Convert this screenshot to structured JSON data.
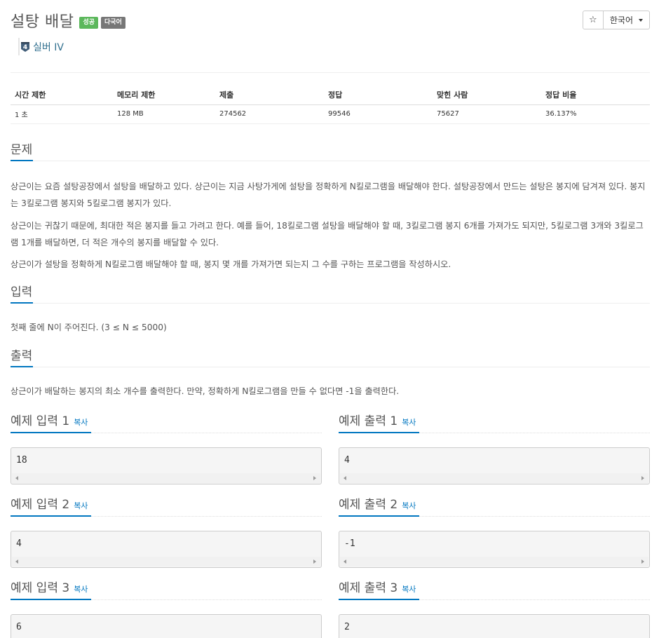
{
  "problem": {
    "title": "설탕 배달",
    "badges": {
      "success": "성공",
      "multilang": "다국어"
    },
    "tier": {
      "level": "4",
      "label": "실버 IV"
    }
  },
  "toolbar": {
    "star": "☆",
    "language": "한국어"
  },
  "info_table": {
    "headers": [
      "시간 제한",
      "메모리 제한",
      "제출",
      "정답",
      "맞힌 사람",
      "정답 비율"
    ],
    "values": [
      "1 초",
      "128 MB",
      "274562",
      "99546",
      "75627",
      "36.137%"
    ]
  },
  "sections": {
    "problem": {
      "heading": "문제",
      "paragraphs": [
        "상근이는 요즘 설탕공장에서 설탕을 배달하고 있다. 상근이는 지금 사탕가게에 설탕을 정확하게 N킬로그램을 배달해야 한다. 설탕공장에서 만드는 설탕은 봉지에 담겨져 있다. 봉지는 3킬로그램 봉지와 5킬로그램 봉지가 있다.",
        "상근이는 귀찮기 때문에, 최대한 적은 봉지를 들고 가려고 한다. 예를 들어, 18킬로그램 설탕을 배달해야 할 때, 3킬로그램 봉지 6개를 가져가도 되지만, 5킬로그램 3개와 3킬로그램 1개를 배달하면, 더 적은 개수의 봉지를 배달할 수 있다.",
        "상근이가 설탕을 정확하게 N킬로그램 배달해야 할 때, 봉지 몇 개를 가져가면 되는지 그 수를 구하는 프로그램을 작성하시오."
      ]
    },
    "input": {
      "heading": "입력",
      "text": "첫째 줄에 N이 주어진다. (3 ≤ N ≤ 5000)"
    },
    "output": {
      "heading": "출력",
      "text": "상근이가 배달하는 봉지의 최소 개수를 출력한다. 만약, 정확하게 N킬로그램을 만들 수 없다면 -1을 출력한다."
    }
  },
  "examples": {
    "copy_label": "복사",
    "items": [
      {
        "input_title": "예제 입력 1",
        "input": "18",
        "output_title": "예제 출력 1",
        "output": "4"
      },
      {
        "input_title": "예제 입력 2",
        "input": "4",
        "output_title": "예제 출력 2",
        "output": "-1"
      },
      {
        "input_title": "예제 입력 3",
        "input": "6",
        "output_title": "예제 출력 3",
        "output": "2"
      }
    ]
  },
  "colors": {
    "accent": "#0076c0",
    "success_badge": "#5cb85c",
    "multilang_badge": "#777777",
    "tier": "#31708f"
  }
}
